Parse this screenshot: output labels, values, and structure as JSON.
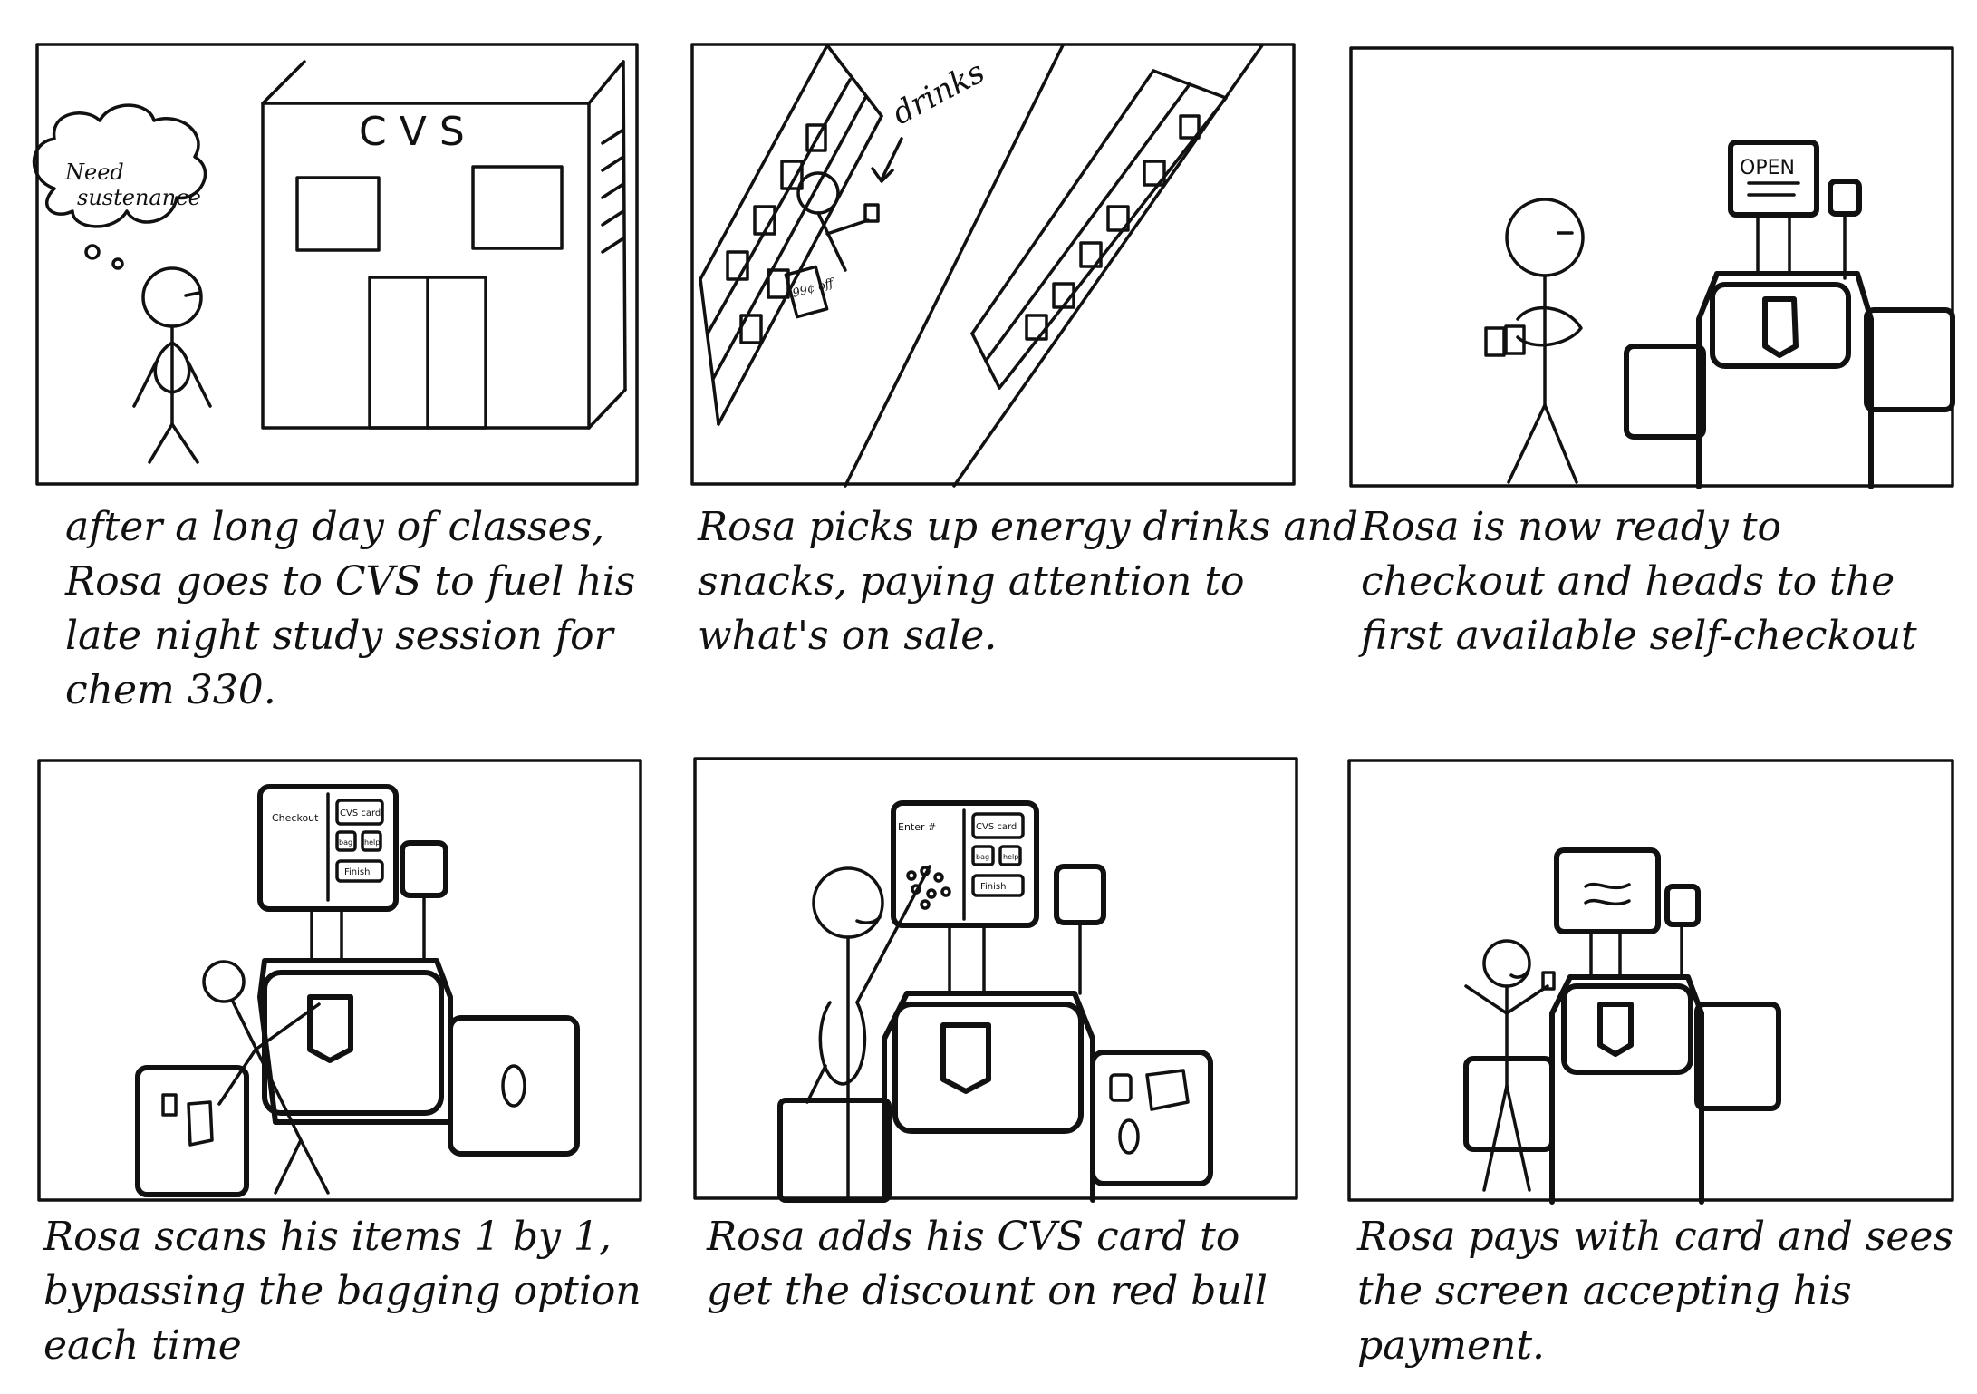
{
  "scenes": [
    {
      "store_sign": "CVS",
      "thought_bubble": [
        "Need",
        "sustenance"
      ],
      "caption": [
        "after a long day of classes,",
        "Rosa goes to CVS to fuel his",
        "late night study session for",
        "chem 330."
      ]
    },
    {
      "aisle_label": "drinks",
      "sale_tag": "99¢ off",
      "caption": [
        "Rosa picks up energy drinks and",
        "snacks, paying attention to",
        "what's on sale."
      ]
    },
    {
      "screen_text": "OPEN",
      "caption": [
        "Rosa is now ready to",
        "checkout and heads to the",
        "first available self-checkout"
      ]
    },
    {
      "screen_labels": [
        "Checkout",
        "CVS card",
        "bag",
        "help",
        "Finish"
      ],
      "caption": [
        "Rosa scans his items 1 by 1,",
        "bypassing the bagging option",
        "each time"
      ]
    },
    {
      "screen_labels": [
        "Enter #",
        "CVS card",
        "bag",
        "help",
        "Finish"
      ],
      "caption": [
        "Rosa adds his CVS card to",
        "get the discount on red bull"
      ]
    },
    {
      "caption": [
        "Rosa pays with card and sees",
        "the screen accepting his",
        "payment."
      ]
    }
  ]
}
